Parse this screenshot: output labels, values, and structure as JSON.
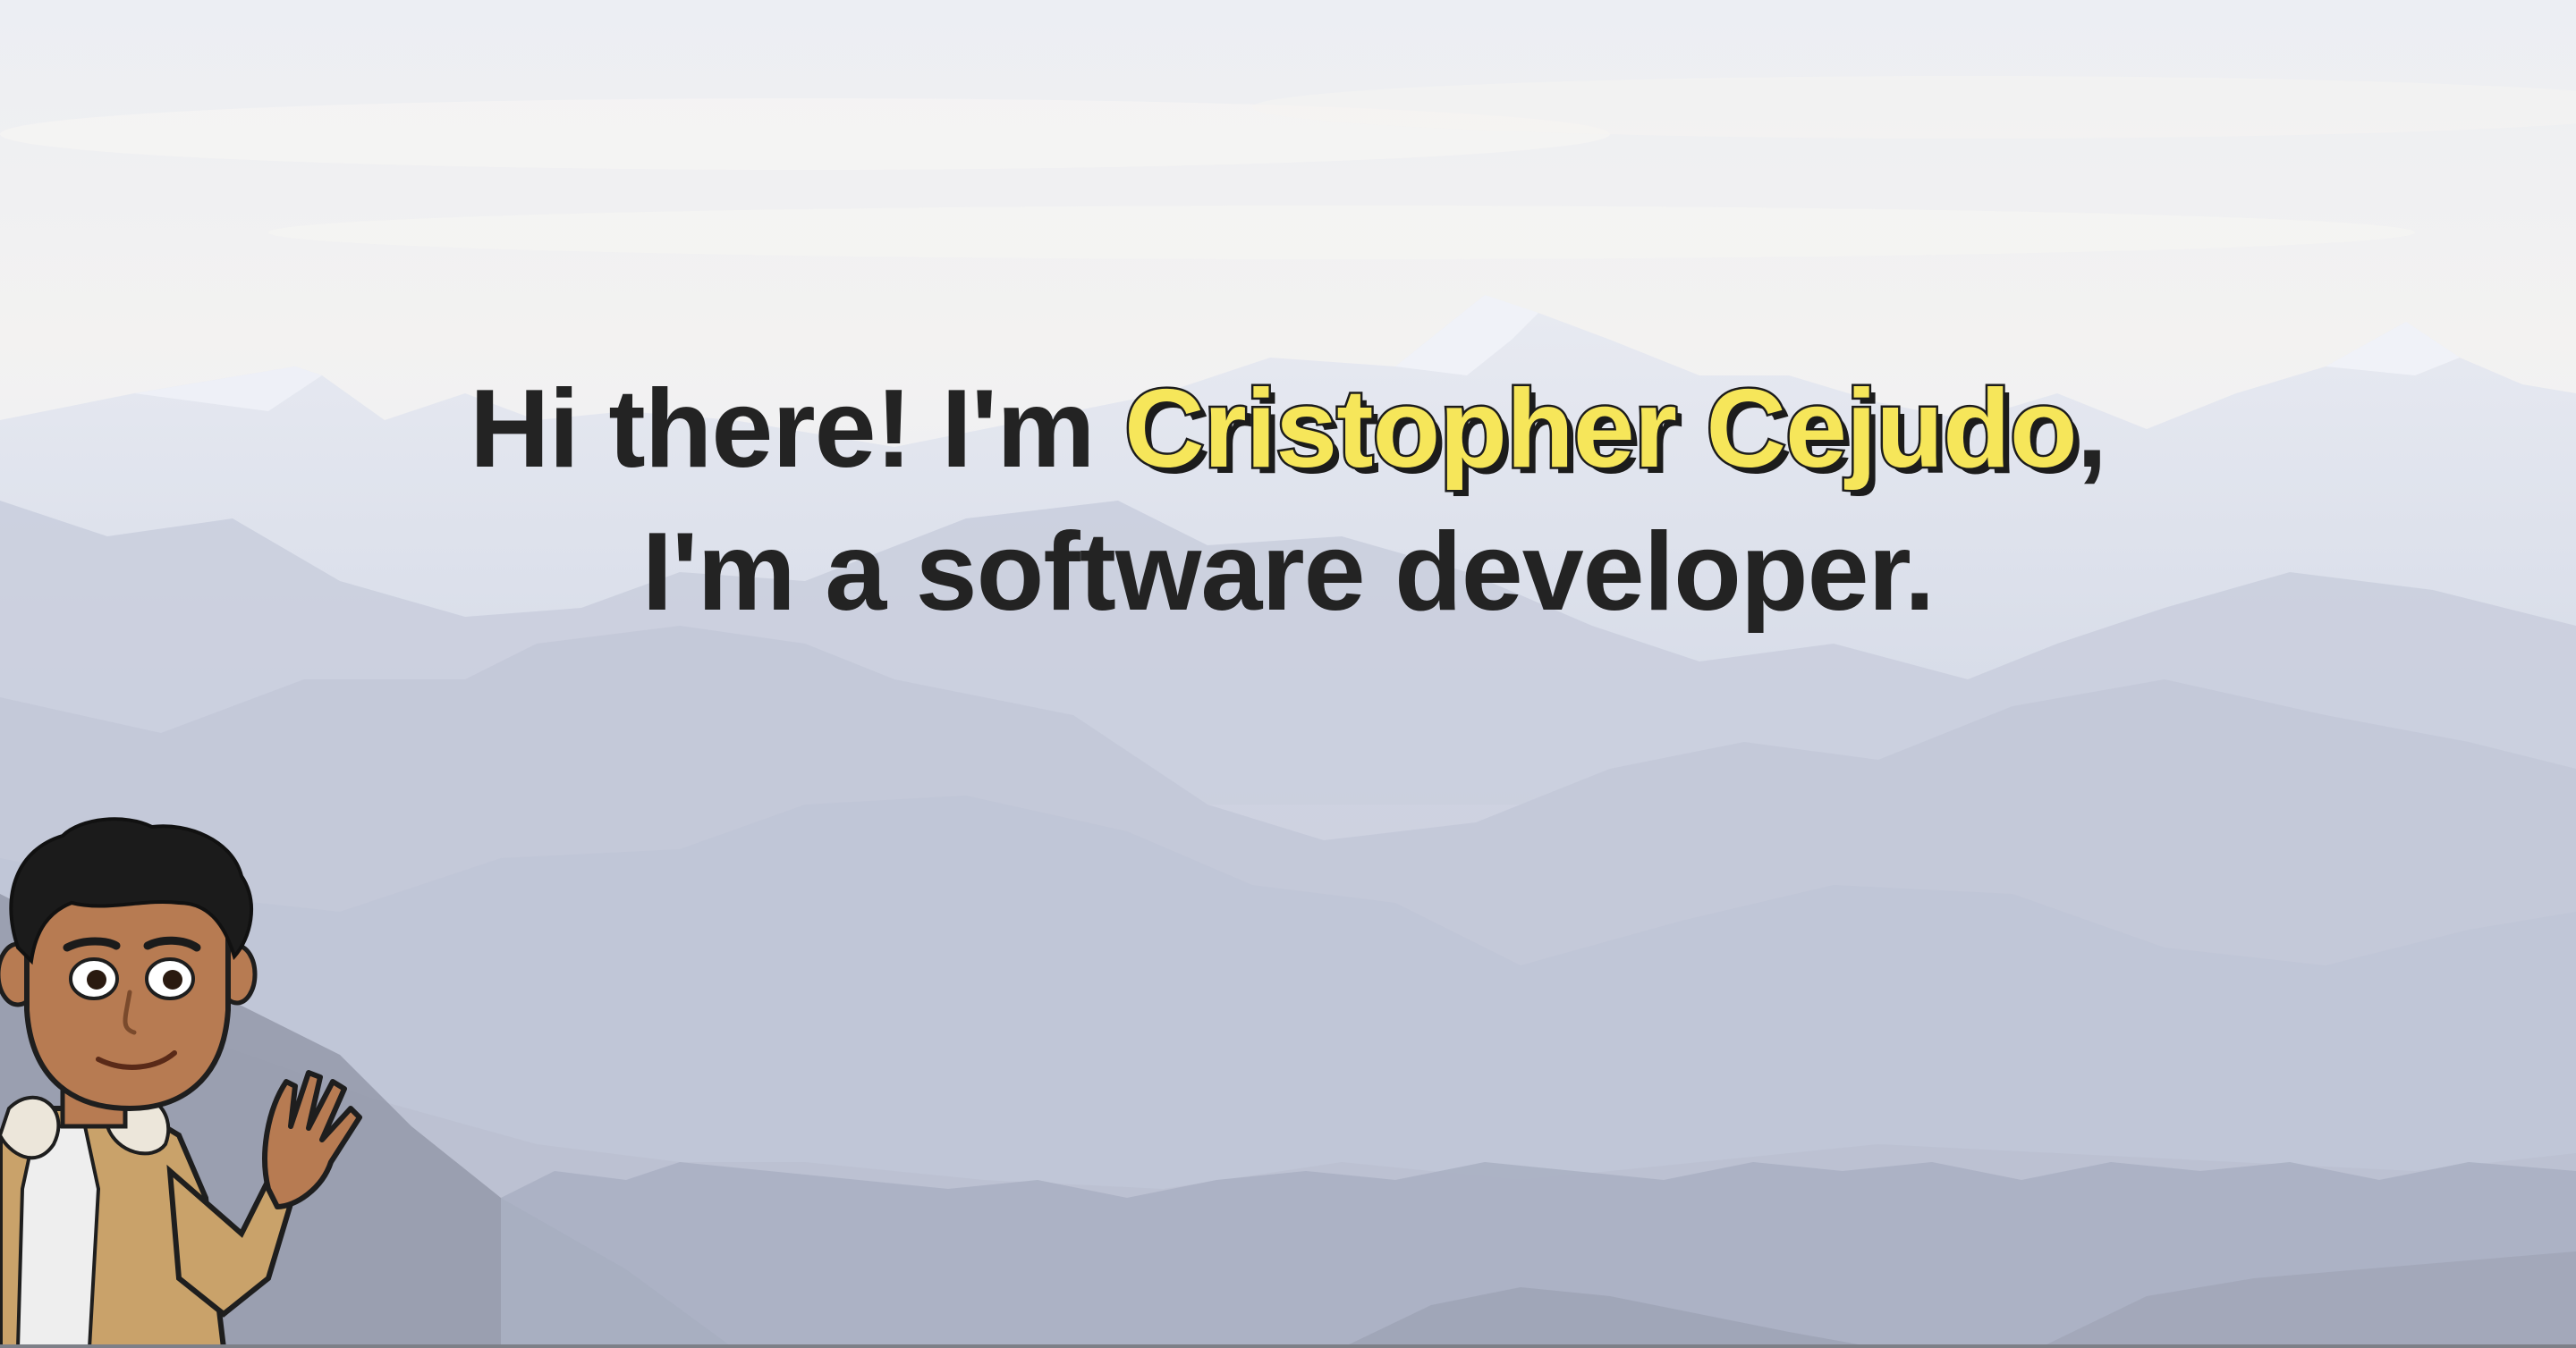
{
  "hero": {
    "line1_prefix": "Hi there! I'm ",
    "name": "Cristopher Cejudo",
    "line1_suffix": ",",
    "line2": "I'm a software developer."
  },
  "colors": {
    "text": "#232323",
    "name_highlight": "#f6e65a",
    "name_outline": "#1c1c1c"
  },
  "icons": {
    "avatar": "waving-bitmoji-avatar-icon"
  }
}
